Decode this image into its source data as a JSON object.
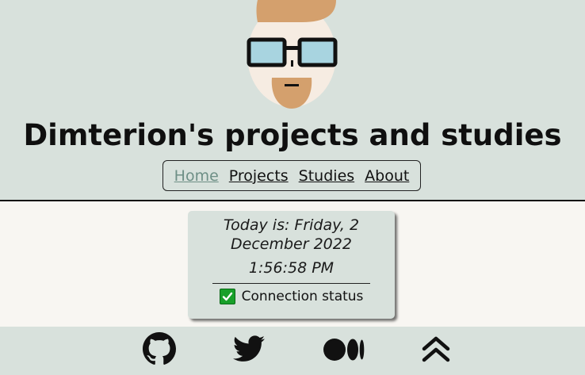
{
  "header": {
    "title": "Dimterion's projects and studies"
  },
  "nav": {
    "items": [
      {
        "label": "Home",
        "active": true
      },
      {
        "label": "Projects",
        "active": false
      },
      {
        "label": "Studies",
        "active": false
      },
      {
        "label": "About",
        "active": false
      }
    ]
  },
  "status_card": {
    "date_text": "Today is: Friday, 2 December 2022",
    "time_text": "1:56:58 PM",
    "status_label": "Connection status"
  },
  "footer": {
    "icons": [
      "github-icon",
      "twitter-icon",
      "medium-icon",
      "scroll-to-top-icon"
    ]
  },
  "colors": {
    "background_header": "#d8e1dc",
    "background_main": "#f8f6f2",
    "nav_active": "#6e8f86",
    "status_ok": "#18a02a"
  }
}
